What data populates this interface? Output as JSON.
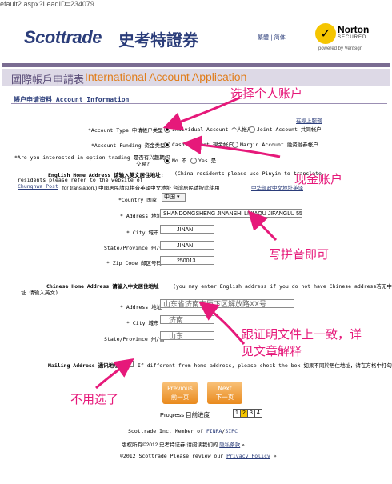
{
  "browser": {
    "url_fragment": "efault2.aspx?LeadID=234079"
  },
  "header": {
    "logo_text": "Scottrade",
    "logo_cn": "史考特證券",
    "lang_links": "繁體 | 简体",
    "norton": {
      "brand": "Norton",
      "secured": "SECURED",
      "by": "powered by VeriSign"
    }
  },
  "title": {
    "cn": "國際帳戶申請表",
    "en": "International Account Application"
  },
  "section": {
    "label": "帳户申请资料 Account Information",
    "help_link": "在線上服務"
  },
  "form": {
    "account_type": {
      "label": "*Account Type 申请帳户类型",
      "opt1": "Individual Account 个人帐户",
      "opt2": "Joint Account 共同帐户"
    },
    "funding": {
      "label": "*Account Funding 资金类型",
      "opt1": "Cash Account 現金帐户",
      "opt2": "Margin Account 融资融券帐户"
    },
    "options": {
      "label": "*Are you interested in option trading 是否有兴趣期权",
      "label2": "交易?",
      "opt1": "No 不",
      "opt2": "Yes 是"
    },
    "english_address": {
      "heading": "English Home Address 请输入英文居住地址:",
      "note": "(China residents please use Pinyin to translate.",
      "note2": "residents please refer to the website of",
      "link": "Chunghwa Post",
      "note3": "for translation.) 中國居民請以拼音英译中文地址 台湾居民请按此使用",
      "link2": "中华邮政中文地址英译",
      "country_label": "*Country 国家",
      "country_value": "中国",
      "address_label": "* Address 地址",
      "address_value": "SHANDONGSHENG JINANSHI LIXIAQU JIFANGLU 55HAO",
      "city_label": "* City 城市",
      "city_value": "JINAN",
      "state_label": "State/Province 州/省",
      "state_value": "JINAN",
      "zip_label": "* Zip Code 邮区号码",
      "zip_value": "250013"
    },
    "chinese_address": {
      "heading": "Chinese Home Address 请输入中文居住地址",
      "note": "(you may enter English address if you do not have Chinese address若无中文地",
      "note2": "址 请输入英文)",
      "address_label": "* Address 地址",
      "address_value": "山东省济南市历下区解放路XX号",
      "city_label": "* City 城市",
      "city_value": "济南",
      "state_label": "State/Province 州/省",
      "state_value": "山东"
    },
    "mailing": {
      "label": "Mailing Address 通讯地址:",
      "note": "If different from home address, please check the box 如果不同於居住地址，请在方格中打勾"
    }
  },
  "buttons": {
    "previous_en": "Previous",
    "previous_cn": "前一页",
    "next_en": "Next",
    "next_cn": "下一页"
  },
  "progress": {
    "label": "Progress 目前进度",
    "steps": [
      "1",
      "2",
      "3",
      "4"
    ],
    "current": 2
  },
  "footer": {
    "line1_pre": "Scottrade Inc. Member of",
    "finra": "FINRA",
    "sipc": "SIPC",
    "line2_pre": "版权所有©2012 史考特证券  请阅读我们的",
    "privacy_cn": "隐私条款",
    "line3_pre": "©2012 Scottrade   Please review our",
    "privacy_en": "Privacy Policy"
  },
  "annotations": {
    "individual": "选择个人账户",
    "cash": "现金账户",
    "pinyin": "写拼音即可",
    "consistent": "跟证明文件上一致，详",
    "consistent2": "见文章解释",
    "skip": "不用选了"
  },
  "colors": {
    "brand": "#2b3d7a",
    "accent": "#e07d1b",
    "annotation": "#e6197a"
  }
}
